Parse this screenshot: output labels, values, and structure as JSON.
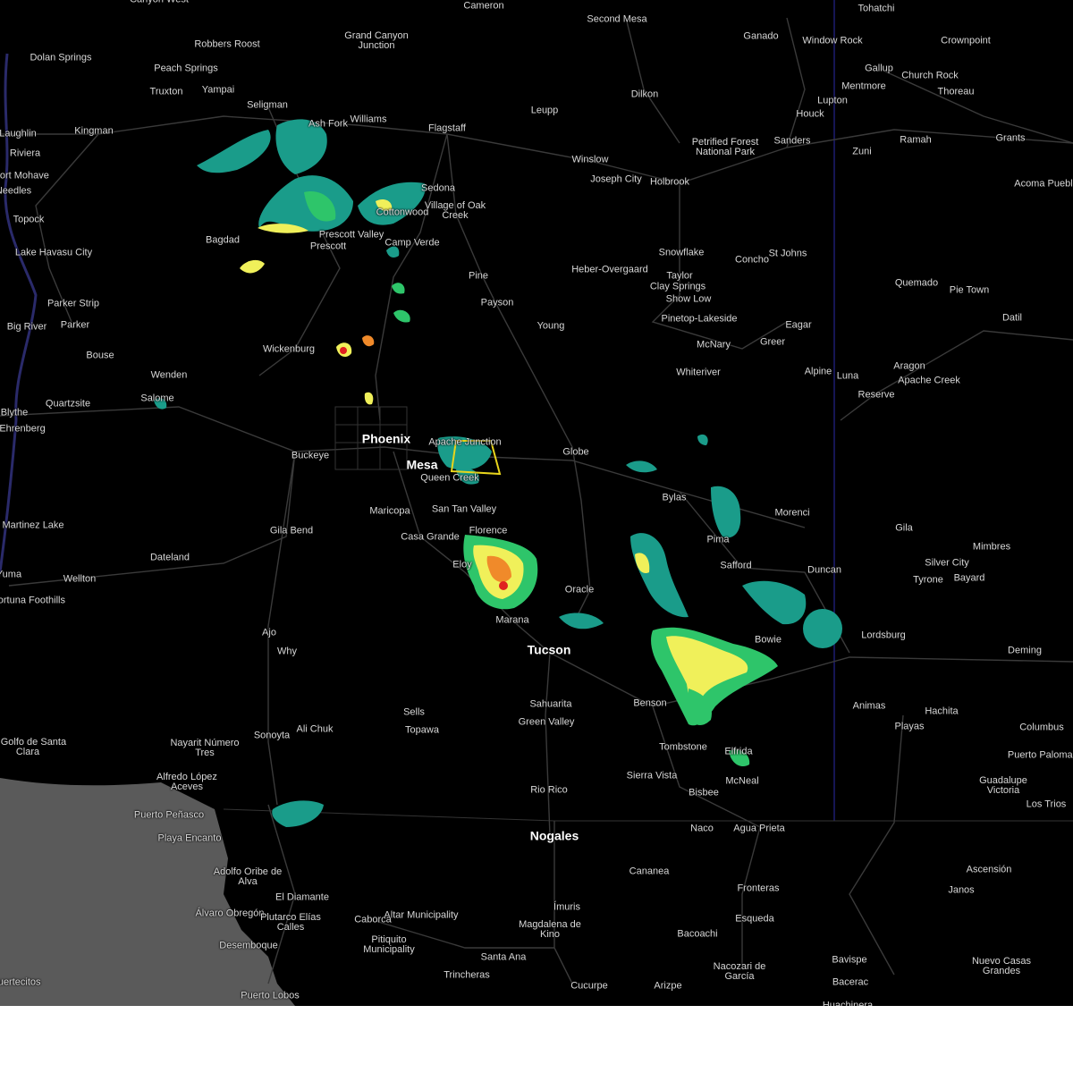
{
  "map": {
    "colors": {
      "background": "#000000",
      "ocean": "#5a5a5a",
      "roads": "#3a3a3a",
      "state_line": "#2a2aa8",
      "warning_polygon": "#e8d51c",
      "radar_light": "#1a9c8a",
      "radar_mid": "#2ec56a",
      "radar_yellow": "#f0f05a",
      "radar_orange": "#f08a2a",
      "radar_red": "#e02020"
    },
    "places": [
      {
        "name": "Canyon West",
        "big": false
      },
      {
        "name": "Cameron",
        "big": false
      },
      {
        "name": "Tohatchi",
        "big": false
      },
      {
        "name": "Second Mesa",
        "big": false
      },
      {
        "name": "Ganado",
        "big": false
      },
      {
        "name": "Window Rock",
        "big": false
      },
      {
        "name": "Crownpoint",
        "big": false
      },
      {
        "name": "Dolan Springs",
        "big": false
      },
      {
        "name": "Robbers Roost",
        "big": false
      },
      {
        "name": "Grand Canyon Junction",
        "big": false
      },
      {
        "name": "Peach Springs",
        "big": false
      },
      {
        "name": "Truxton",
        "big": false
      },
      {
        "name": "Yampai",
        "big": false
      },
      {
        "name": "Gallup",
        "big": false
      },
      {
        "name": "Church Rock",
        "big": false
      },
      {
        "name": "Mentmore",
        "big": false
      },
      {
        "name": "Thoreau",
        "big": false
      },
      {
        "name": "Dilkon",
        "big": false
      },
      {
        "name": "Lupton",
        "big": false
      },
      {
        "name": "Seligman",
        "big": false
      },
      {
        "name": "Leupp",
        "big": false
      },
      {
        "name": "Houck",
        "big": false
      },
      {
        "name": "Laughlin",
        "big": false
      },
      {
        "name": "Kingman",
        "big": false
      },
      {
        "name": "Ash Fork",
        "big": false
      },
      {
        "name": "Williams",
        "big": false
      },
      {
        "name": "Flagstaff",
        "big": false
      },
      {
        "name": "Ramah",
        "big": false
      },
      {
        "name": "Grants",
        "big": false
      },
      {
        "name": "Petrified Forest National Park",
        "big": false
      },
      {
        "name": "Sanders",
        "big": false
      },
      {
        "name": "Riviera",
        "big": false
      },
      {
        "name": "Fort Mohave",
        "big": false
      },
      {
        "name": "Needles",
        "big": false
      },
      {
        "name": "Zuni",
        "big": false
      },
      {
        "name": "Winslow",
        "big": false
      },
      {
        "name": "Joseph City",
        "big": false
      },
      {
        "name": "Holbrook",
        "big": false
      },
      {
        "name": "Acoma Pueblo",
        "big": false
      },
      {
        "name": "Sedona",
        "big": false
      },
      {
        "name": "Cottonwood",
        "big": false
      },
      {
        "name": "Village of Oak Creek",
        "big": false
      },
      {
        "name": "Topock",
        "big": false
      },
      {
        "name": "Prescott Valley",
        "big": false
      },
      {
        "name": "Bagdad",
        "big": false
      },
      {
        "name": "Camp Verde",
        "big": false
      },
      {
        "name": "Lake Havasu City",
        "big": false
      },
      {
        "name": "Prescott",
        "big": false
      },
      {
        "name": "Snowflake",
        "big": false
      },
      {
        "name": "St Johns",
        "big": false
      },
      {
        "name": "Concho",
        "big": false
      },
      {
        "name": "Heber-Overgaard",
        "big": false
      },
      {
        "name": "Taylor",
        "big": false
      },
      {
        "name": "Pine",
        "big": false
      },
      {
        "name": "Clay Springs",
        "big": false
      },
      {
        "name": "Quemado",
        "big": false
      },
      {
        "name": "Pie Town",
        "big": false
      },
      {
        "name": "Show Low",
        "big": false
      },
      {
        "name": "Parker Strip",
        "big": false
      },
      {
        "name": "Payson",
        "big": false
      },
      {
        "name": "Pinetop-Lakeside",
        "big": false
      },
      {
        "name": "Datil",
        "big": false
      },
      {
        "name": "Eagar",
        "big": false
      },
      {
        "name": "Big River",
        "big": false
      },
      {
        "name": "Parker",
        "big": false
      },
      {
        "name": "Young",
        "big": false
      },
      {
        "name": "McNary",
        "big": false
      },
      {
        "name": "Greer",
        "big": false
      },
      {
        "name": "Wickenburg",
        "big": false
      },
      {
        "name": "Bouse",
        "big": false
      },
      {
        "name": "Aragon",
        "big": false
      },
      {
        "name": "Alpine",
        "big": false
      },
      {
        "name": "Luna",
        "big": false
      },
      {
        "name": "Whiteriver",
        "big": false
      },
      {
        "name": "Wenden",
        "big": false
      },
      {
        "name": "Apache Creek",
        "big": false
      },
      {
        "name": "Reserve",
        "big": false
      },
      {
        "name": "Salome",
        "big": false
      },
      {
        "name": "Quartzsite",
        "big": false
      },
      {
        "name": "Blythe",
        "big": false
      },
      {
        "name": "Ehrenberg",
        "big": false
      },
      {
        "name": "Apache Junction",
        "big": false
      },
      {
        "name": "Phoenix",
        "big": true
      },
      {
        "name": "Globe",
        "big": false
      },
      {
        "name": "Buckeye",
        "big": false
      },
      {
        "name": "Mesa",
        "big": true
      },
      {
        "name": "Queen Creek",
        "big": false
      },
      {
        "name": "Bylas",
        "big": false
      },
      {
        "name": "San Tan Valley",
        "big": false
      },
      {
        "name": "Maricopa",
        "big": false
      },
      {
        "name": "Morenci",
        "big": false
      },
      {
        "name": "Martinez Lake",
        "big": false
      },
      {
        "name": "Gila Bend",
        "big": false
      },
      {
        "name": "Gila",
        "big": false
      },
      {
        "name": "Florence",
        "big": false
      },
      {
        "name": "Casa Grande",
        "big": false
      },
      {
        "name": "Pima",
        "big": false
      },
      {
        "name": "Mimbres",
        "big": false
      },
      {
        "name": "Dateland",
        "big": false
      },
      {
        "name": "Safford",
        "big": false
      },
      {
        "name": "Silver City",
        "big": false
      },
      {
        "name": "Eloy",
        "big": false
      },
      {
        "name": "Duncan",
        "big": false
      },
      {
        "name": "Yuma",
        "big": false
      },
      {
        "name": "Wellton",
        "big": false
      },
      {
        "name": "Tyrone",
        "big": false
      },
      {
        "name": "Bayard",
        "big": false
      },
      {
        "name": "Oracle",
        "big": false
      },
      {
        "name": "Fortuna Foothills",
        "big": false
      },
      {
        "name": "Marana",
        "big": false
      },
      {
        "name": "Lordsburg",
        "big": false
      },
      {
        "name": "Ajo",
        "big": false
      },
      {
        "name": "Bowie",
        "big": false
      },
      {
        "name": "Tucson",
        "big": true
      },
      {
        "name": "Why",
        "big": false
      },
      {
        "name": "Deming",
        "big": false
      },
      {
        "name": "Benson",
        "big": false
      },
      {
        "name": "Sahuarita",
        "big": false
      },
      {
        "name": "Animas",
        "big": false
      },
      {
        "name": "Hachita",
        "big": false
      },
      {
        "name": "Sells",
        "big": false
      },
      {
        "name": "Green Valley",
        "big": false
      },
      {
        "name": "Playas",
        "big": false
      },
      {
        "name": "Columbus",
        "big": false
      },
      {
        "name": "Topawa",
        "big": false
      },
      {
        "name": "Ali Chuk",
        "big": false
      },
      {
        "name": "Sonoyta",
        "big": false
      },
      {
        "name": "El Golfo de Santa Clara",
        "big": false
      },
      {
        "name": "Tombstone",
        "big": false
      },
      {
        "name": "Nayarit Número Tres",
        "big": false
      },
      {
        "name": "Elfrida",
        "big": false
      },
      {
        "name": "Puerto Palomas",
        "big": false
      },
      {
        "name": "Sierra Vista",
        "big": false
      },
      {
        "name": "McNeal",
        "big": false
      },
      {
        "name": "Alfredo López Aceves",
        "big": false
      },
      {
        "name": "Guadalupe Victoria",
        "big": false
      },
      {
        "name": "Rio Rico",
        "big": false
      },
      {
        "name": "Bisbee",
        "big": false
      },
      {
        "name": "Los Trios",
        "big": false
      },
      {
        "name": "Puerto Peñasco",
        "big": false
      },
      {
        "name": "Playa Encanto",
        "big": false
      },
      {
        "name": "Naco",
        "big": false
      },
      {
        "name": "Agua Prieta",
        "big": false
      },
      {
        "name": "Nogales",
        "big": true
      },
      {
        "name": "Ascensión",
        "big": false
      },
      {
        "name": "Cananea",
        "big": false
      },
      {
        "name": "Adolfo Oribe de Alva",
        "big": false
      },
      {
        "name": "Fronteras",
        "big": false
      },
      {
        "name": "Janos",
        "big": false
      },
      {
        "name": "El Diamante",
        "big": false
      },
      {
        "name": "Álvaro Obregón",
        "big": false
      },
      {
        "name": "Altar Municipality",
        "big": false
      },
      {
        "name": "Ímuris",
        "big": false
      },
      {
        "name": "Plutarco Elías Calles",
        "big": false
      },
      {
        "name": "Caborca",
        "big": false
      },
      {
        "name": "Esqueda",
        "big": false
      },
      {
        "name": "Magdalena de Kino",
        "big": false
      },
      {
        "name": "Pitiquito Municipality",
        "big": false
      },
      {
        "name": "Bacoachi",
        "big": false
      },
      {
        "name": "Desemboque",
        "big": false
      },
      {
        "name": "Santa Ana",
        "big": false
      },
      {
        "name": "Nuevo Casas Grandes",
        "big": false
      },
      {
        "name": "Bavispe",
        "big": false
      },
      {
        "name": "Trincheras",
        "big": false
      },
      {
        "name": "Nacozari de García",
        "big": false
      },
      {
        "name": "Puertecitos",
        "big": false
      },
      {
        "name": "Cucurpe",
        "big": false
      },
      {
        "name": "Arizpe",
        "big": false
      },
      {
        "name": "Bacerac",
        "big": false
      },
      {
        "name": "Puerto Lobos",
        "big": false
      },
      {
        "name": "Huachinera",
        "big": false
      }
    ]
  }
}
